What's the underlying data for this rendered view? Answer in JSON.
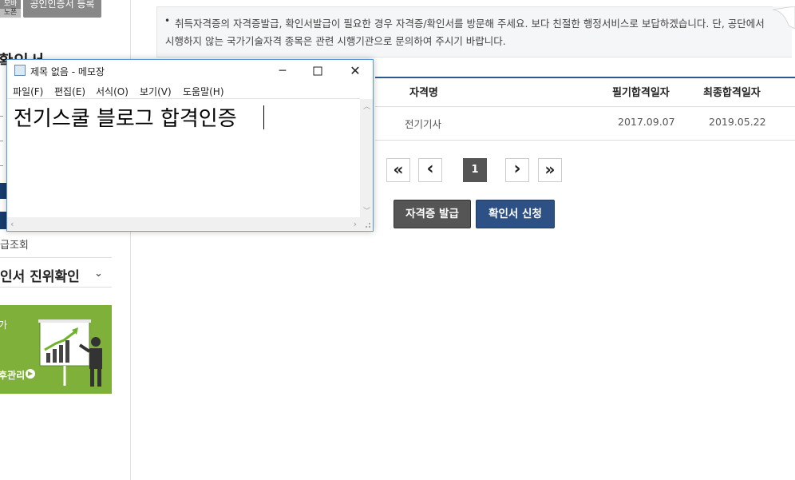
{
  "sidebar": {
    "mobile_btn_top": "모바",
    "mobile_btn_bottom": "노폰",
    "register_btn": "공인인증서 등록",
    "heading": "확인서",
    "issue_item": "급조회",
    "verify_section": "인서 진위확인",
    "banner_text": "후관리",
    "banner_side": "가"
  },
  "notice": {
    "bullet": "•",
    "text": "취득자격증의 자격증발급, 확인서발급이 필요한 경우 자격증/확인서를 방문해 주세요. 보다 친절한 행정서비스로 보답하겠습니다. 단, 공단에서 시행하지 않는 국가기술자격 종목은 관련 시행기관으로 문의하여 주시기 바랍니다."
  },
  "table": {
    "headers": [
      "자격명",
      "필기합격일자",
      "최종합격일자"
    ],
    "rows": [
      {
        "name": "전기기사",
        "written_date": "2017.09.07",
        "final_date": "2019.05.22"
      }
    ]
  },
  "pagination": {
    "first": "«",
    "prev": "‹",
    "current": "1",
    "next": "›",
    "last": "»"
  },
  "actions": {
    "issue_label": "자격증 발급",
    "apply_label": "확인서 신청"
  },
  "notepad": {
    "title": "제목 없음 - 메모장",
    "menus": [
      "파일(F)",
      "편집(E)",
      "서식(O)",
      "보기(V)",
      "도움말(H)"
    ],
    "content": "전기스쿨 블로그 합격인증",
    "minimize": "─",
    "close": "✕"
  },
  "colors": {
    "accent_blue": "#2d5185",
    "dark_button": "#555555",
    "banner_green": "#7fb03a",
    "window_border": "#5a9bd5"
  }
}
